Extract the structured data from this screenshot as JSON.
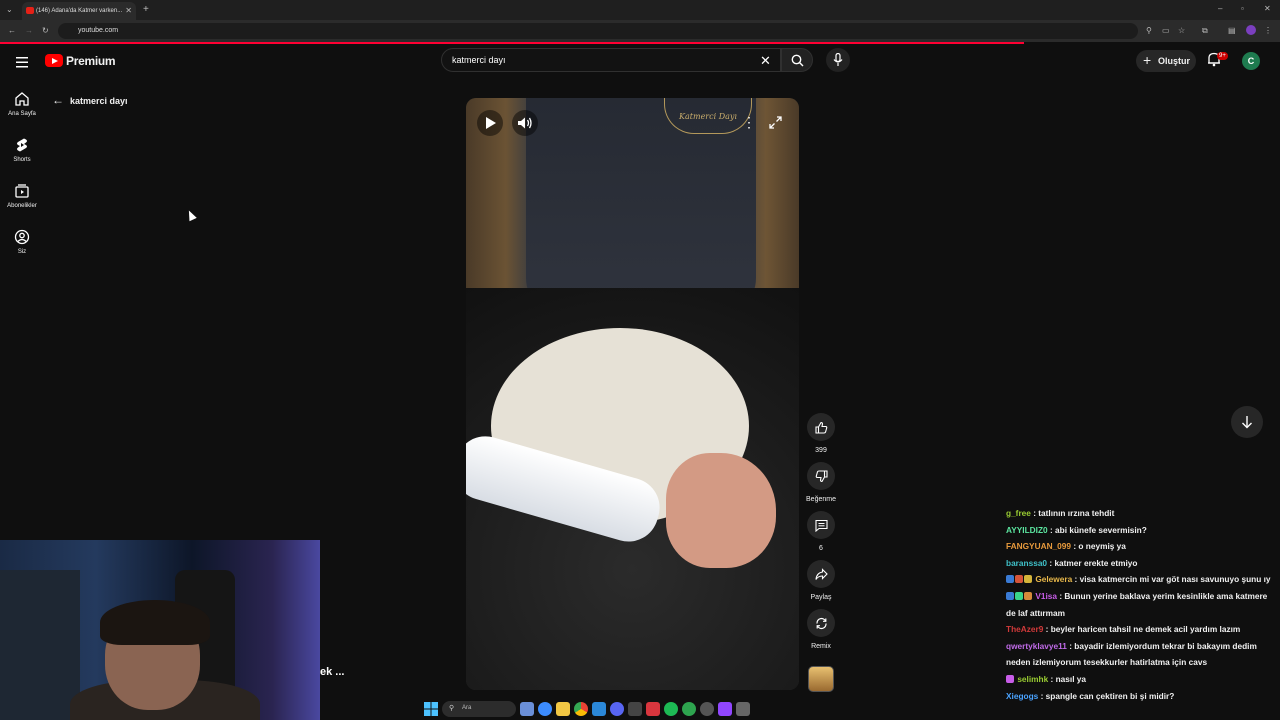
{
  "browser": {
    "tab_title": "(146) Adana'da Katmer varken...",
    "url": "youtube.com",
    "new_tab_glyph": "+"
  },
  "header": {
    "logo_text": "Premium",
    "search_value": "katmerci dayı",
    "create_label": "Oluştur",
    "notification_count": "9+",
    "avatar_initial": "C"
  },
  "sidebar": {
    "items": [
      {
        "label": "Ana Sayfa",
        "icon": "home-icon"
      },
      {
        "label": "Shorts",
        "icon": "shorts-icon"
      },
      {
        "label": "Abonelikler",
        "icon": "subscriptions-icon"
      },
      {
        "label": "Siz",
        "icon": "you-icon"
      }
    ],
    "back_title": "katmerci dayı"
  },
  "video": {
    "watermark": "Katmerci Dayı"
  },
  "actions": {
    "like_count": "399",
    "dislike_label": "Beğenme",
    "comment_count": "6",
    "share_label": "Paylaş",
    "remix_label": "Remix"
  },
  "webcam": {
    "overlay_text": "ek ..."
  },
  "chat": [
    {
      "user": "g_free",
      "color": "#9acd32",
      "text": ": tatlının ırzına tehdit"
    },
    {
      "user": "AYYILDIZ0",
      "color": "#5ce6a0",
      "text": ": abi künefe severmisin?"
    },
    {
      "user": "FANGYUAN_099",
      "color": "#e89a3c",
      "text": ": o neymiş ya"
    },
    {
      "user": "baranssa0",
      "color": "#3fc1c9",
      "text": ": katmer erekte etmiyo"
    },
    {
      "user": "Gelewera",
      "color": "#e8b84a",
      "text": ": visa katmercin mi var göt nası savunuyo şunu ıy"
    },
    {
      "user": "V1isa",
      "color": "#c85de8",
      "text": ": Bunun yerine baklava yerim kesinlikle ama katmere de laf attırmam"
    },
    {
      "user": "TheAzer9",
      "color": "#d23a3a",
      "text": ": beyler haricen tahsil ne demek acil yardım lazım"
    },
    {
      "user": "qwertyklavye11",
      "color": "#c06be8",
      "text": ": bayadir izlemiyordum tekrar bi bakayım dedim neden izlemiyorum tesekkurler hatirlatma için cavs"
    },
    {
      "user": "selimhk",
      "color": "#9acd32",
      "text": ": nasıl ya"
    },
    {
      "user": "Xiegogs",
      "color": "#4aa3ff",
      "text": ": spangle can çektiren bi şi midir?"
    }
  ],
  "taskbar": {
    "search_placeholder": "Ara"
  },
  "colors": {
    "yt_red": "#ff0000",
    "progress_red": "#ff0033",
    "avatar_green": "#1e7b4f",
    "background": "#0f0f0f"
  }
}
